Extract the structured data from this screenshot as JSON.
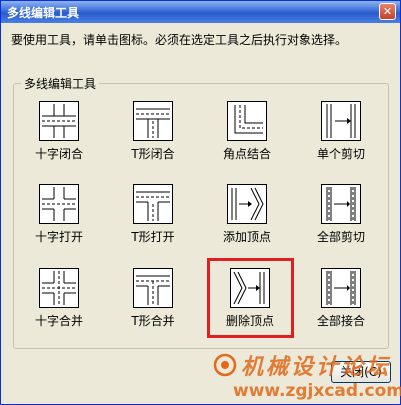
{
  "window": {
    "title": "多线编辑工具",
    "close_glyph": "✕"
  },
  "instruction": "要使用工具，请单击图标。必须在选定工具之后执行对象选择。",
  "group_label": "多线编辑工具",
  "tools": [
    {
      "label": "十字闭合",
      "icon": "cross-closed-icon"
    },
    {
      "label": "T形闭合",
      "icon": "tee-closed-icon"
    },
    {
      "label": "角点结合",
      "icon": "corner-joint-icon"
    },
    {
      "label": "单个剪切",
      "icon": "cut-single-icon"
    },
    {
      "label": "十字打开",
      "icon": "cross-open-icon"
    },
    {
      "label": "T形打开",
      "icon": "tee-open-icon"
    },
    {
      "label": "添加顶点",
      "icon": "add-vertex-icon"
    },
    {
      "label": "全部剪切",
      "icon": "cut-all-icon"
    },
    {
      "label": "十字合并",
      "icon": "cross-merged-icon"
    },
    {
      "label": "T形合并",
      "icon": "tee-merged-icon"
    },
    {
      "label": "删除顶点",
      "icon": "delete-vertex-icon"
    },
    {
      "label": "全部接合",
      "icon": "weld-all-icon"
    }
  ],
  "close_button": "关闭(C)",
  "watermark": {
    "text": "机械设计论坛",
    "url": "www.zgjxcad.com"
  },
  "colors": {
    "highlight": "#E02020",
    "titlebar": "#2A5BCE",
    "watermark": "#E06A1A"
  }
}
